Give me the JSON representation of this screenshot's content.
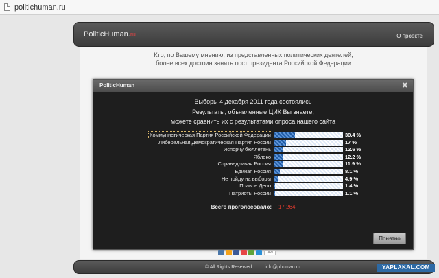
{
  "browser": {
    "url": "politichuman.ru"
  },
  "header": {
    "logo_main": "PoliticHuman.",
    "logo_accent": "ru",
    "about_link": "О проекте"
  },
  "question": {
    "line1": "Кто, по Вашему мнению, из представленных политических деятелей,",
    "line2": "более всех достоин занять пост президента Российской Федерации"
  },
  "modal": {
    "title": "PoliticHuman",
    "close_glyph": "✖",
    "intro": [
      "Выборы 4 декабря 2011 года состоялись",
      "Результаты, объявленные ЦИК Вы знаете,",
      "можете сравнить их с результатами опроса нашего сайта"
    ],
    "total_label": "Всего проголосовало:",
    "total_value": "17 264",
    "ok_label": "Понятно"
  },
  "chart_data": {
    "type": "bar",
    "orientation": "horizontal",
    "categories": [
      "Коммунистическая Партия Российской Федерации",
      "Либеральная Демократическая Партия России",
      "Испорчу бюллетень",
      "Яблоко",
      "Справедливая Россия",
      "Единая Россия",
      "Не пойду на выборы",
      "Правое Дело",
      "Патриоты России"
    ],
    "values": [
      30.4,
      17,
      12.6,
      12.2,
      11.9,
      8.1,
      4.9,
      1.4,
      1.1
    ],
    "labels": [
      "30.4 %",
      "17 %",
      "12.6 %",
      "12.2 %",
      "11.9 %",
      "8.1 %",
      "4.9 %",
      "1.4 %",
      "1.1 %"
    ],
    "xlim": [
      0,
      100
    ],
    "selected_index": 0,
    "colors": {
      "fill": "#1f5aa3",
      "track": "#ffffff"
    }
  },
  "share": {
    "count": "369",
    "colors": [
      "#4a76a8",
      "#f4a21a",
      "#3b5998",
      "#e64646",
      "#5fa33a",
      "#2b8fd6"
    ]
  },
  "footer": {
    "copyright": "© All Rights Reserved",
    "email": "info@phuman.ru"
  },
  "watermark": "YAPLAKAL.COM"
}
